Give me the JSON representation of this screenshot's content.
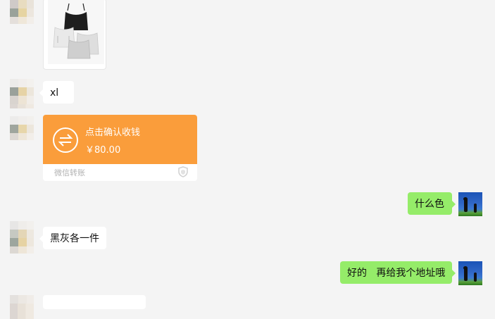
{
  "messages": {
    "xl_text": "xl",
    "transfer": {
      "title": "点击确认收钱",
      "amount": "￥80.00",
      "footer": "微信转账"
    },
    "what_color": "什么色",
    "black_gray": "黑灰各一件",
    "ok_address": "好的   再给我个地址哦"
  },
  "colors": {
    "background": "#f4f4f4",
    "sent_bubble": "#95ec69",
    "received_bubble": "#ffffff",
    "transfer_orange": "#fa9d3b"
  },
  "icons": {
    "transfer": "transfer-arrows-icon",
    "shield": "shield-icon"
  }
}
